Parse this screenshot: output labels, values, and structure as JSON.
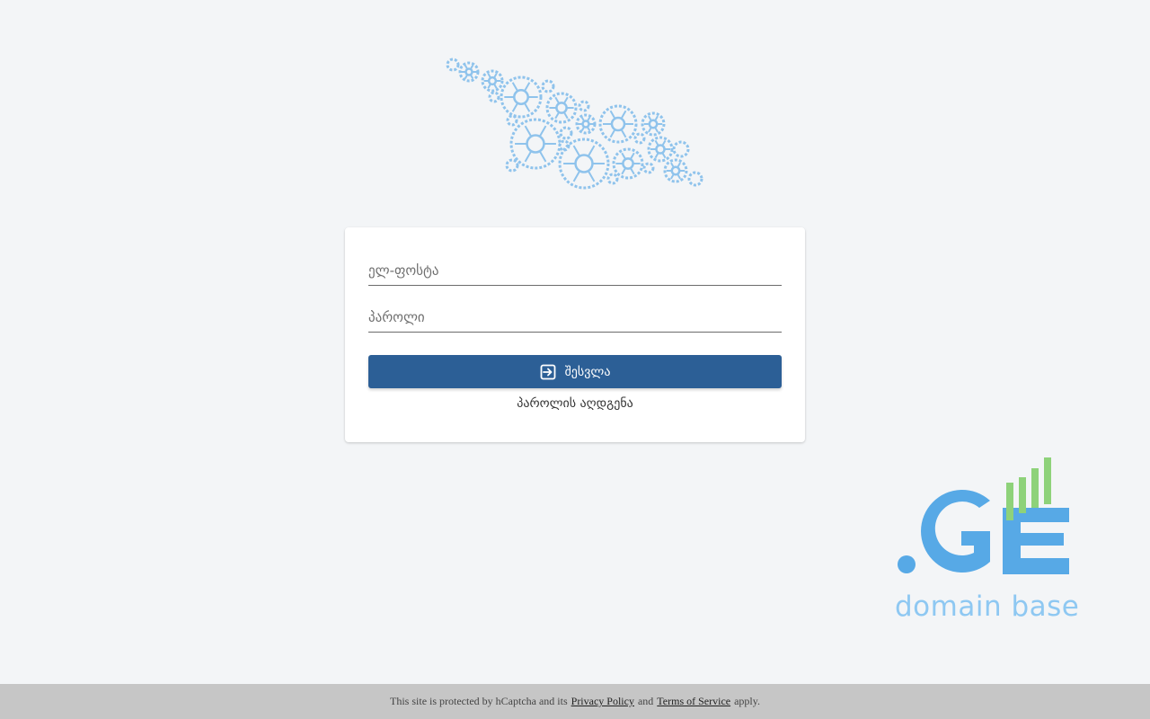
{
  "login_form": {
    "email_placeholder": "ელ-ფოსტა",
    "password_placeholder": "პაროლი",
    "login_button_label": "შესვლა",
    "reset_password_link": "პაროლის აღდგენა"
  },
  "brand": {
    "domain_text": "domain base",
    "logo_text": ".GE",
    "colors": {
      "logo_blue": "#57a9e6",
      "logo_green": "#8ed27a",
      "gears": "#8fc3ec",
      "button": "#2c5f96"
    }
  },
  "footer": {
    "text_before": "This site is protected by hCaptcha and its",
    "privacy_link": "Privacy Policy",
    "text_middle": "and",
    "terms_link": "Terms of Service",
    "text_after": "apply."
  }
}
